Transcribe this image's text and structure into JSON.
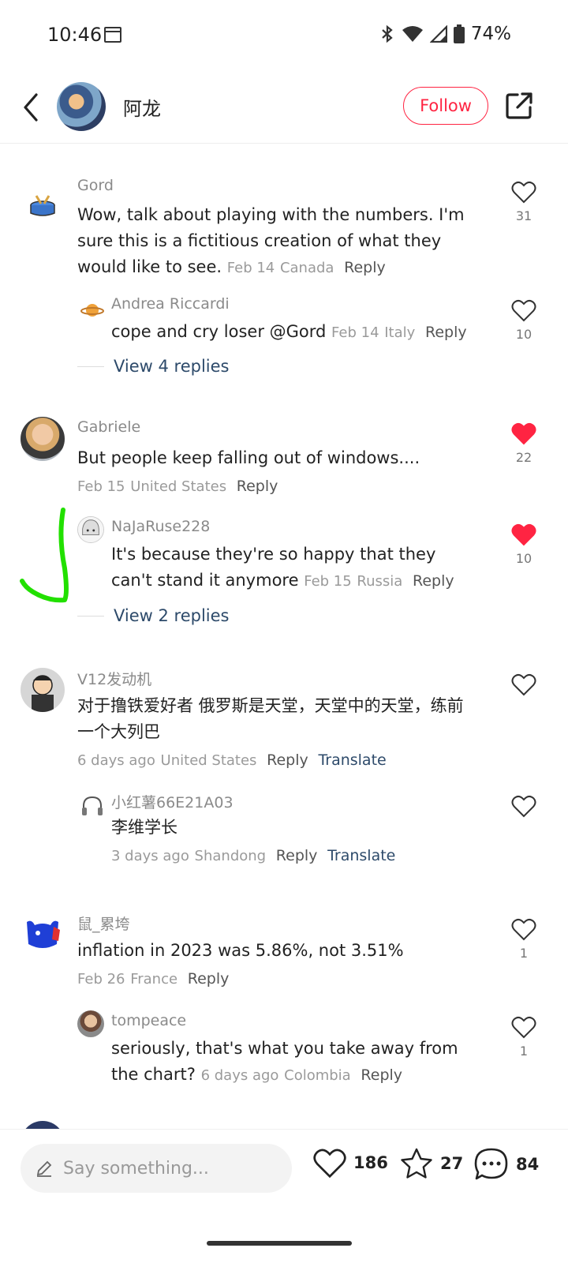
{
  "status_bar": {
    "time": "10:46",
    "battery": "74%"
  },
  "header": {
    "name": "阿龙",
    "follow_label": "Follow"
  },
  "comments": [
    {
      "user": "Gord",
      "text": "Wow, talk about playing with the numbers. I'm sure this is a fictitious creation of what they would like to see.",
      "date": "Feb 14",
      "location": "Canada",
      "reply": "Reply",
      "likes": "31",
      "liked": false
    },
    {
      "user": "Andrea Riccardi",
      "text": "cope and cry loser @Gord",
      "date": "Feb 14",
      "location": "Italy",
      "reply": "Reply",
      "likes": "10",
      "liked": false
    },
    {
      "view_replies": "View 4 replies"
    },
    {
      "user": "Gabriele",
      "text": "But people keep falling out of windows....",
      "date": "Feb 15",
      "location": "United States",
      "reply": "Reply",
      "likes": "22",
      "liked": true
    },
    {
      "user": "NaJaRuse228",
      "text": "It's because they're so happy that they can't stand it anymore",
      "date": "Feb 15",
      "location": "Russia",
      "reply": "Reply",
      "likes": "10",
      "liked": true
    },
    {
      "view_replies": "View 2 replies"
    },
    {
      "user": "V12发动机",
      "text": "对于撸铁爱好者 俄罗斯是天堂，天堂中的天堂，练前一个大列巴",
      "date": "6 days ago",
      "location": "United States",
      "reply": "Reply",
      "translate": "Translate",
      "likes": "",
      "liked": false
    },
    {
      "user": "小红薯66E21A03",
      "text": "李维学长",
      "date": "3 days ago",
      "location": "Shandong",
      "reply": "Reply",
      "translate": "Translate",
      "likes": "",
      "liked": false
    },
    {
      "user": "鼠_累垮",
      "text": "inflation in 2023 was 5.86%, not 3.51%",
      "date": "Feb 26",
      "location": "France",
      "reply": "Reply",
      "likes": "1",
      "liked": false
    },
    {
      "user": "tompeace",
      "text": "seriously, that's what you take away from the chart?",
      "date": "6 days ago",
      "location": "Colombia",
      "reply": "Reply",
      "likes": "1",
      "liked": false
    }
  ],
  "bottom_bar": {
    "placeholder": "Say something...",
    "likes": "186",
    "stars": "27",
    "comments": "84"
  },
  "colors": {
    "accent": "#ff2442",
    "link": "#2d4a6a",
    "annotation": "#22e000"
  }
}
